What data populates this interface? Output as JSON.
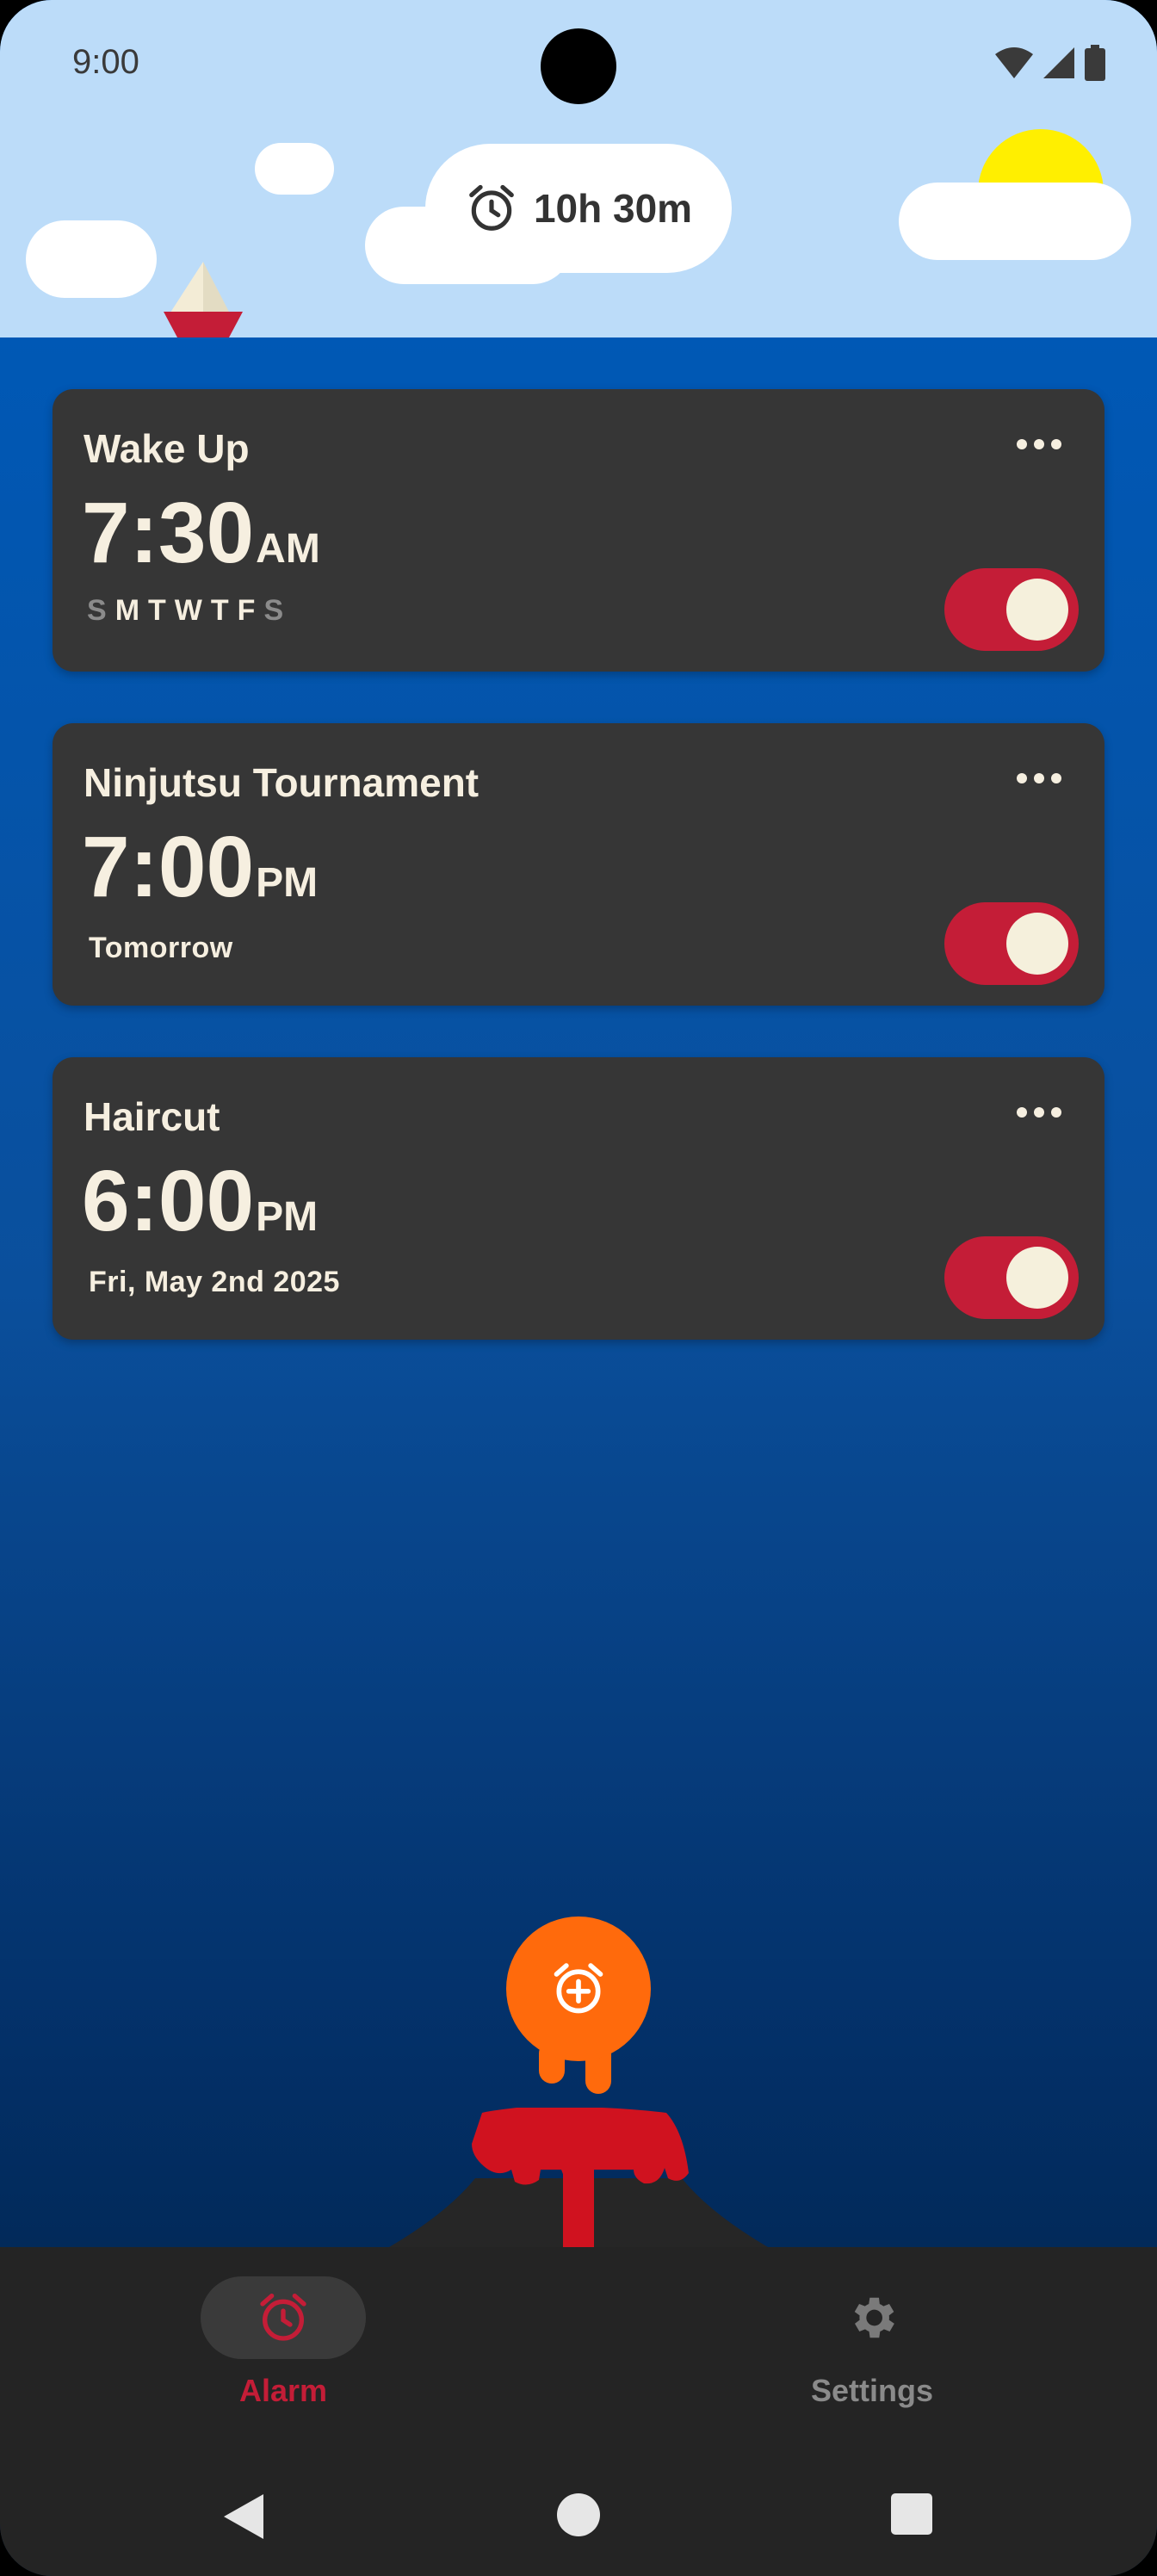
{
  "status_bar": {
    "time": "9:00"
  },
  "next_alarm": {
    "time_until": "10h 30m",
    "icon": "alarm-clock-icon"
  },
  "alarms": [
    {
      "label": "Wake Up",
      "time": "7:30",
      "period": "AM",
      "repeat_days": [
        "S",
        "M",
        "T",
        "W",
        "T",
        "F",
        "S"
      ],
      "active_days": [
        false,
        true,
        true,
        true,
        true,
        true,
        false
      ],
      "enabled": true
    },
    {
      "label": "Ninjutsu Tournament",
      "time": "7:00",
      "period": "PM",
      "schedule": "Tomorrow",
      "enabled": true
    },
    {
      "label": "Haircut",
      "time": "6:00",
      "period": "PM",
      "schedule": "Fri, May 2nd 2025",
      "enabled": true
    }
  ],
  "fab": {
    "icon": "add-alarm-icon"
  },
  "nav": {
    "alarm": {
      "label": "Alarm",
      "icon": "alarm-icon",
      "selected": true
    },
    "settings": {
      "label": "Settings",
      "icon": "gear-icon",
      "selected": false
    }
  },
  "colors": {
    "accent": "#c41d37",
    "lava": "#d0121f",
    "fab": "#ff6a0c",
    "sky": "#bcdcf9",
    "sea": "#0058b5",
    "card": "#363636",
    "cream": "#f6efe0"
  }
}
